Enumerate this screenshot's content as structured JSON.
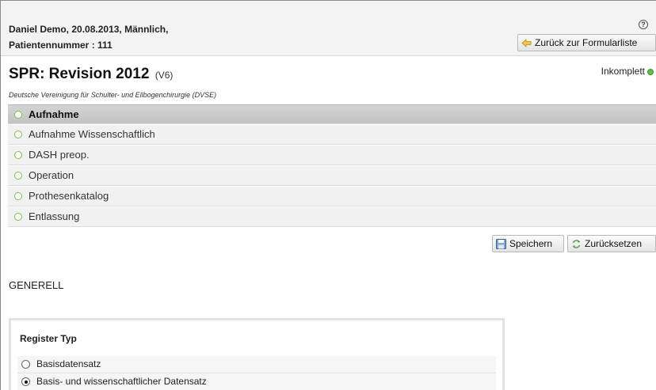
{
  "header": {
    "patient_line1": "Daniel Demo, 20.08.2013, Männlich,",
    "patient_line2": "Patientennummer : 111",
    "help_glyph": "?",
    "back_button": "Zurück zur Formularliste"
  },
  "form": {
    "title": "SPR: Revision 2012",
    "version": "(V6)",
    "status": "Inkomplett",
    "status_color": "#5cc04a",
    "subtitle": "Deutsche Vereinigung für Schulter- und Ellbogenchirurgie (DVSE)"
  },
  "sections": [
    {
      "label": "Aufnahme",
      "active": true
    },
    {
      "label": "Aufnahme Wissenschaftlich",
      "active": false
    },
    {
      "label": "DASH preop.",
      "active": false
    },
    {
      "label": "Operation",
      "active": false
    },
    {
      "label": "Prothesenkatalog",
      "active": false
    },
    {
      "label": "Entlassung",
      "active": false
    }
  ],
  "actions": {
    "save": "Speichern",
    "reset": "Zurücksetzen"
  },
  "content": {
    "section_heading": "GENERELL",
    "register": {
      "title": "Register Typ",
      "options": [
        {
          "label": "Basisdatensatz",
          "selected": false
        },
        {
          "label": "Basis- und wissenschaftlicher Datensatz",
          "selected": true
        }
      ]
    }
  },
  "colors": {
    "accent_green": "#7abf4a",
    "header_bg": "#f3f3f3",
    "active_row": "#c8c8c8"
  }
}
